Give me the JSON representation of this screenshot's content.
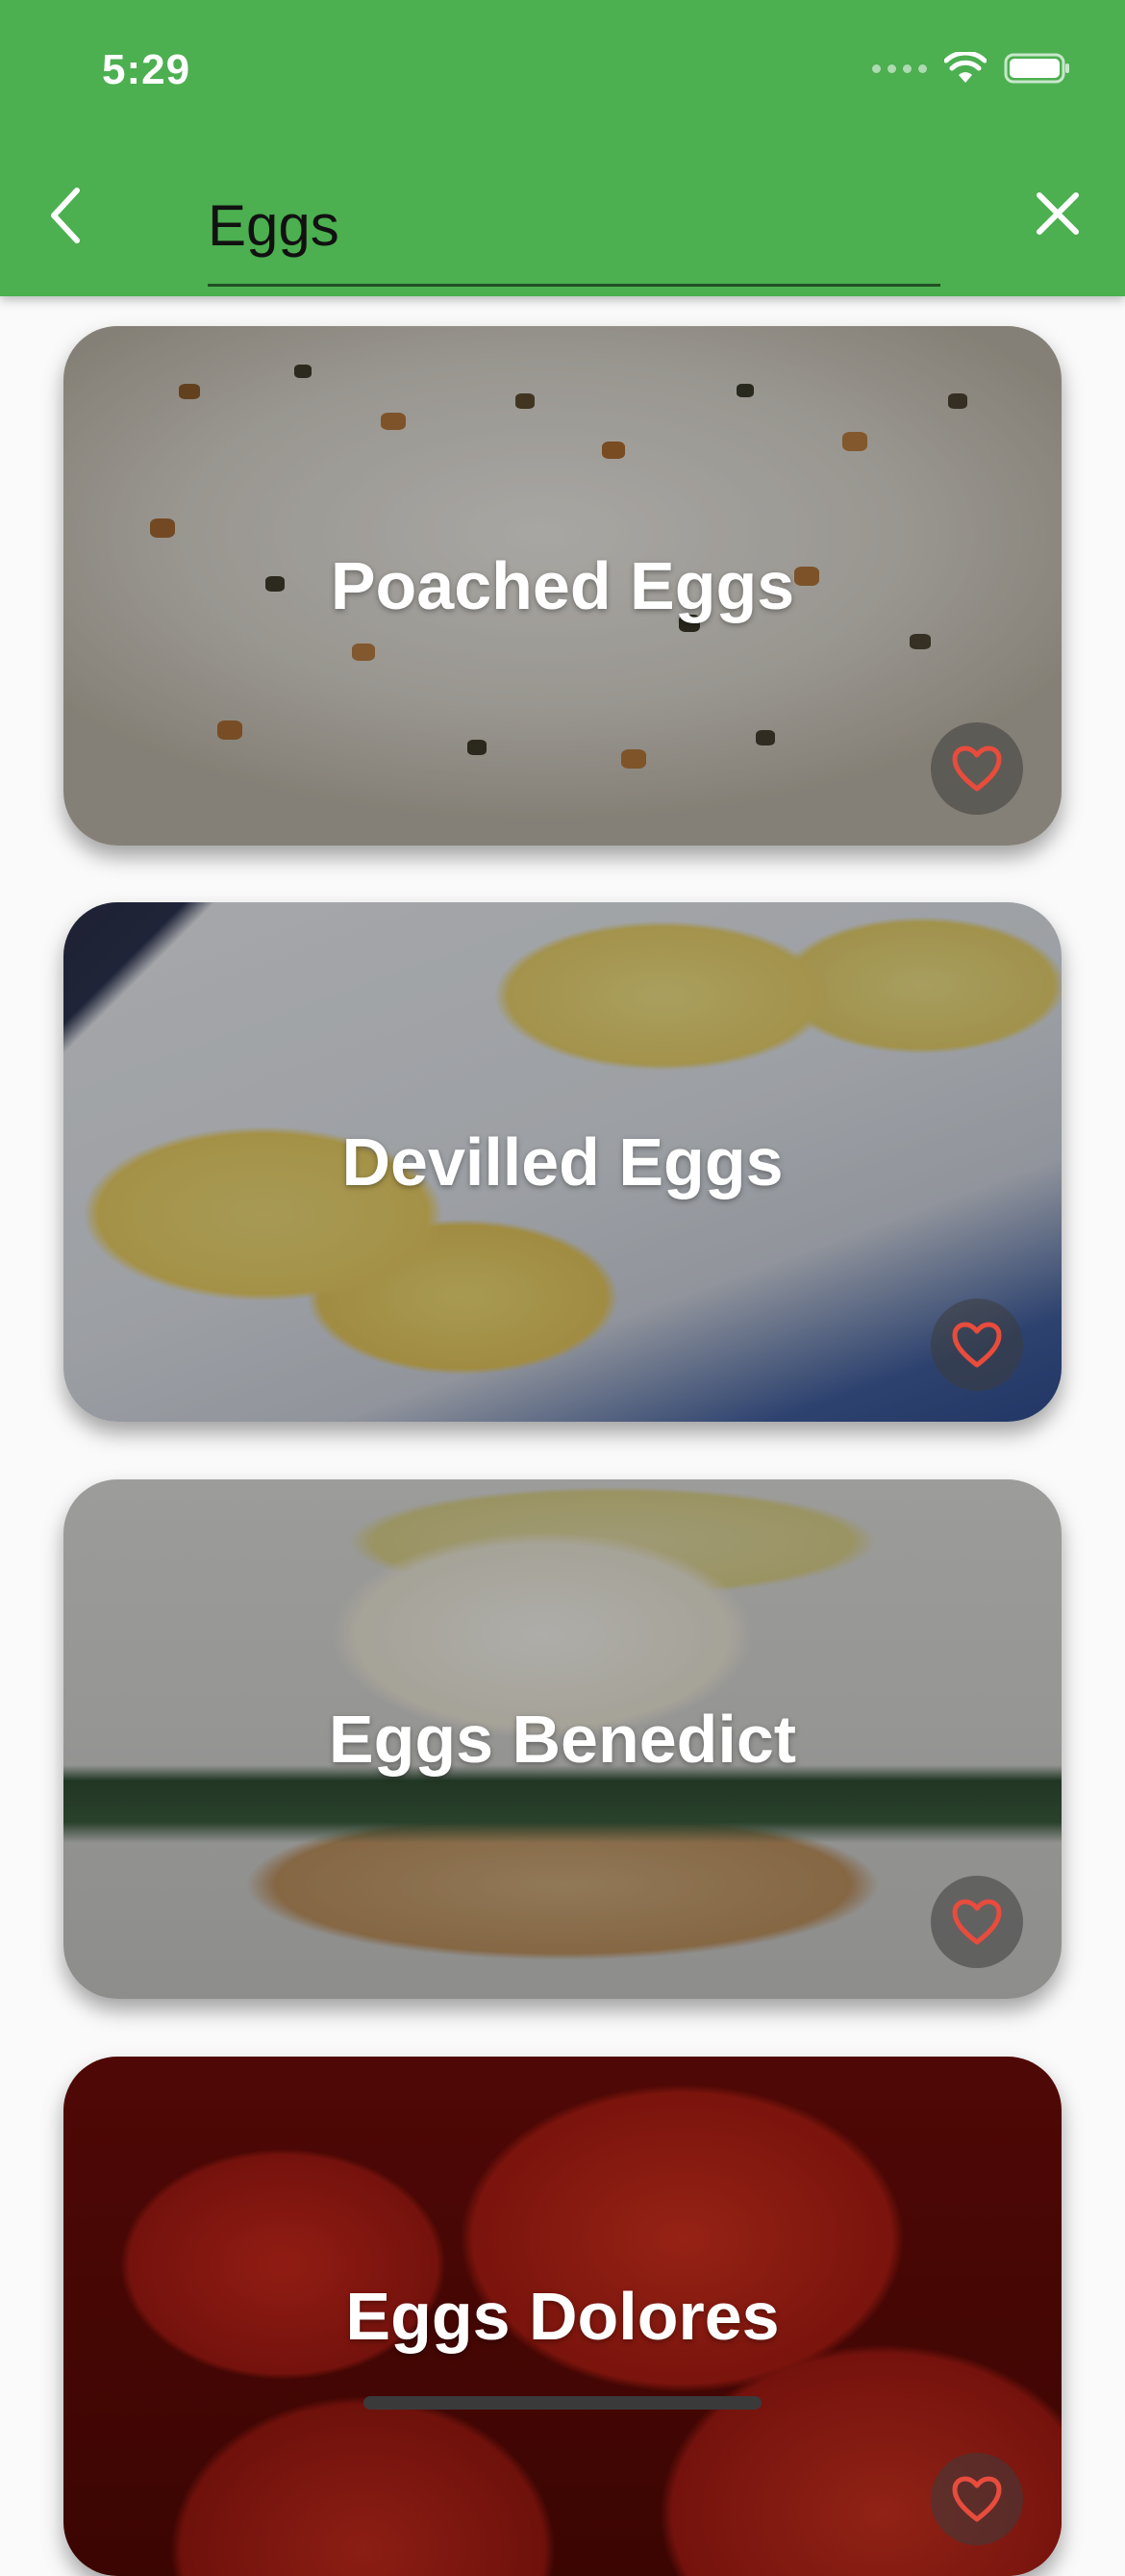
{
  "status_bar": {
    "time": "5:29"
  },
  "search": {
    "value": "Eggs",
    "placeholder": ""
  },
  "colors": {
    "app_bar": "#4caf50",
    "favorite": "#e74c3c"
  },
  "icons": {
    "back": "chevron-left-icon",
    "clear": "close-icon",
    "favorite": "heart-outline-icon",
    "wifi": "wifi-icon",
    "battery": "battery-icon"
  },
  "recipes": [
    {
      "title": "Poached Eggs",
      "favorite": false
    },
    {
      "title": "Devilled Eggs",
      "favorite": false
    },
    {
      "title": "Eggs Benedict",
      "favorite": false
    },
    {
      "title": "Eggs Dolores",
      "favorite": false
    }
  ]
}
